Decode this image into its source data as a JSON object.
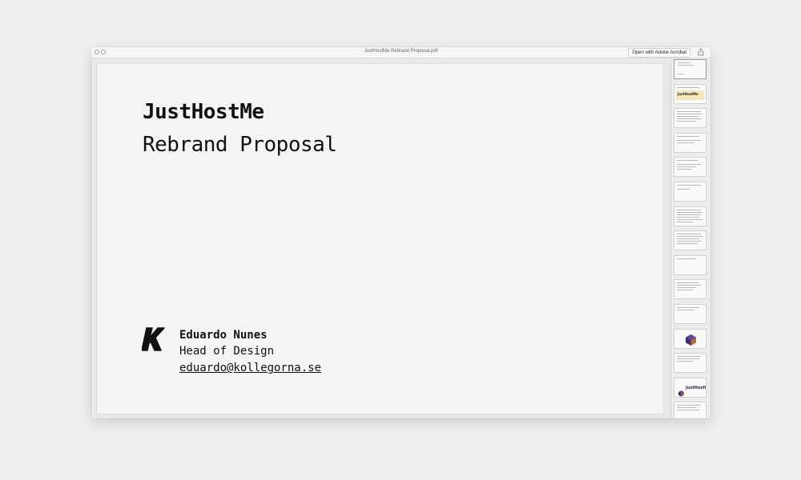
{
  "window": {
    "title": "JustHostMe Rebrand Proposal.pdf",
    "open_button_label": "Open with Adobe Acrobat"
  },
  "page": {
    "title": "JustHostMe",
    "subtitle": "Rebrand Proposal",
    "author": {
      "name": "Eduardo Nunes",
      "role": "Head of Design",
      "email": "eduardo@kollegorna.se"
    }
  },
  "thumbnails": {
    "count": 15,
    "active_index": 0,
    "brand_word": "JustHostMe"
  },
  "colors": {
    "background": "#efefef",
    "page": "#f4f4f4",
    "text": "#111111",
    "thumb_highlight": "#f6e6bd",
    "cube_purple": "#3c2f6e",
    "cube_orange": "#e07a3a"
  }
}
